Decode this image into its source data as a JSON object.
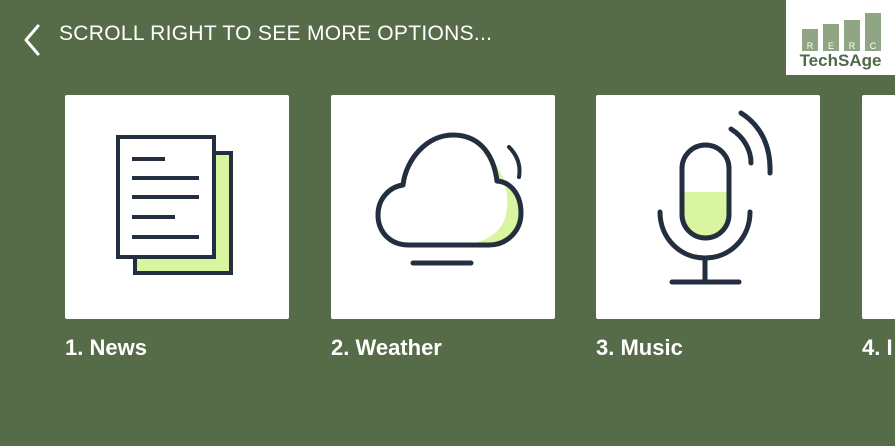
{
  "header": {
    "title": "SCROLL RIGHT TO SEE MORE OPTIONS...",
    "back_icon": "chevron-left-icon"
  },
  "logo": {
    "text": "TechSAge",
    "bar_letters": [
      "R",
      "E",
      "R",
      "C"
    ]
  },
  "cards": [
    {
      "label": "1. News",
      "icon": "news-document-icon"
    },
    {
      "label": "2. Weather",
      "icon": "cloud-weather-icon"
    },
    {
      "label": "3. Music",
      "icon": "microphone-icon"
    },
    {
      "label": "4. I",
      "icon": ""
    }
  ],
  "colors": {
    "background": "#566b48",
    "card": "#ffffff",
    "icon_stroke": "#232f3e",
    "icon_accent": "#d9f5a0",
    "logo_green": "#8fa583"
  }
}
